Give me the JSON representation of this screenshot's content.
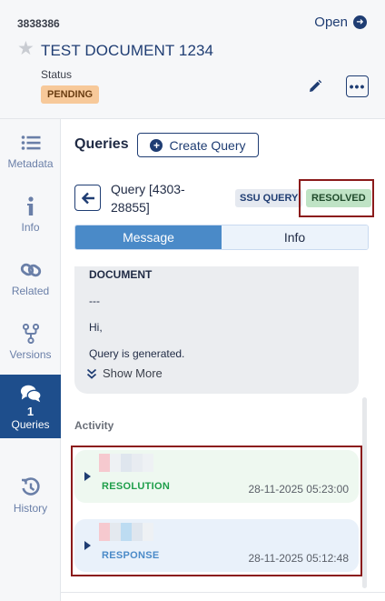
{
  "header": {
    "doc_id": "3838386",
    "open_label": "Open",
    "title": "TEST DOCUMENT 1234",
    "status_label": "Status",
    "status_value": "PENDING",
    "status_color": "#f7c99a"
  },
  "sidebar": {
    "items": [
      {
        "label": "Metadata",
        "icon": "list-icon"
      },
      {
        "label": "Info",
        "icon": "info-icon"
      },
      {
        "label": "Related",
        "icon": "link-icon"
      },
      {
        "label": "Versions",
        "icon": "branch-icon"
      },
      {
        "label": "Queries",
        "count": "1",
        "icon": "chat-icon",
        "active": true
      },
      {
        "label": "History",
        "icon": "history-icon"
      }
    ],
    "active_color": "#1e4e8c"
  },
  "queries": {
    "title": "Queries",
    "create_label": "Create Query"
  },
  "query": {
    "title": "Query [4303-28855]",
    "source_badge": "SSU QUERY",
    "state_badge": "RESOLVED",
    "state_color": "#bfe3c5"
  },
  "tabs": {
    "message": "Message",
    "info": "Info",
    "active": "Message"
  },
  "message": {
    "lines": [
      "DOCUMENT",
      "---",
      "Hi,",
      "Query is generated."
    ],
    "show_more": "Show More"
  },
  "activity": {
    "label": "Activity",
    "entries": [
      {
        "type": "RESOLUTION",
        "time": "28-11-2025 05:23:00",
        "color": "#1e9e4a"
      },
      {
        "type": "RESPONSE",
        "time": "28-11-2025 05:12:48",
        "color": "#4a8ac8"
      }
    ]
  }
}
